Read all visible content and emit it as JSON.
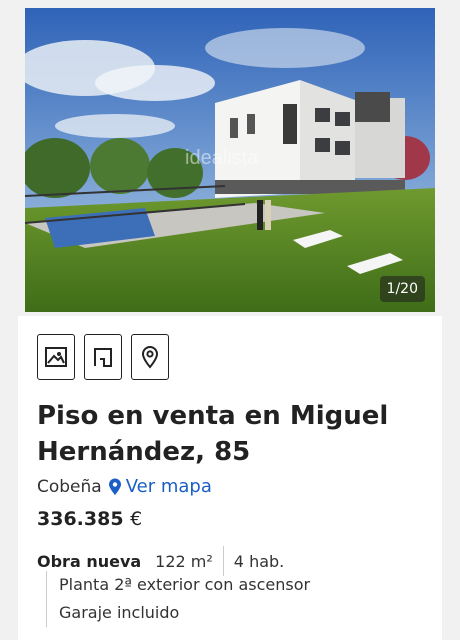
{
  "gallery": {
    "counter": "1/20",
    "watermark": "idealista"
  },
  "toolbar": {
    "photos_icon": "image-icon",
    "plan_icon": "floor-plan-icon",
    "map_icon": "map-pin-icon"
  },
  "listing": {
    "title": "Piso en venta en Miguel Hernández, 85",
    "location": "Cobeña",
    "map_link": "Ver mapa",
    "price_value": "336.385",
    "price_currency": "€",
    "status": "Obra nueva",
    "area": "122 m²",
    "rooms": "4 hab.",
    "details": [
      "Planta 2ª exterior con ascensor",
      "Garaje incluido"
    ]
  },
  "colors": {
    "link": "#1b5fc6",
    "text": "#222222",
    "background": "#f1f1f1"
  }
}
